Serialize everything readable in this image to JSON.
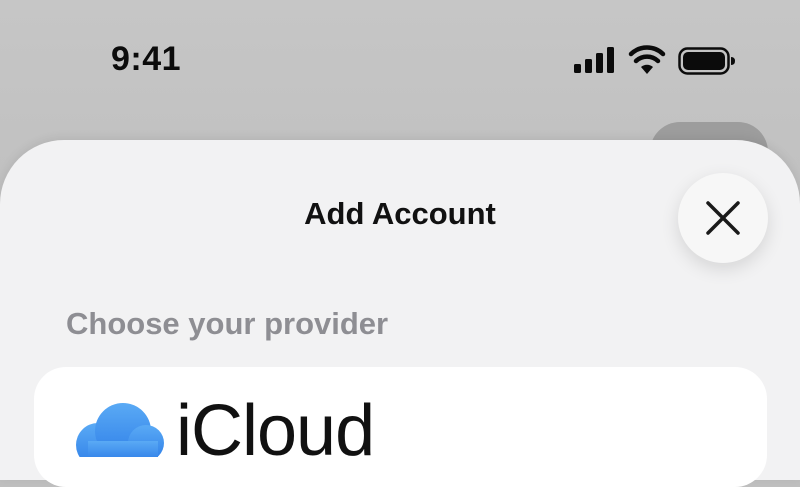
{
  "status_bar": {
    "time": "9:41",
    "icons": [
      "signal-icon",
      "wifi-icon",
      "battery-icon"
    ]
  },
  "sheet": {
    "title": "Add Account",
    "close_icon": "close-icon",
    "section_label": "Choose your provider",
    "providers": [
      {
        "name": "iCloud",
        "icon": "icloud-icon"
      }
    ]
  },
  "colors": {
    "sheet_background": "#f2f2f3",
    "secondary_text": "#8e8e93",
    "primary_text": "#111111",
    "icloud_blue": "#3a8ff0"
  }
}
